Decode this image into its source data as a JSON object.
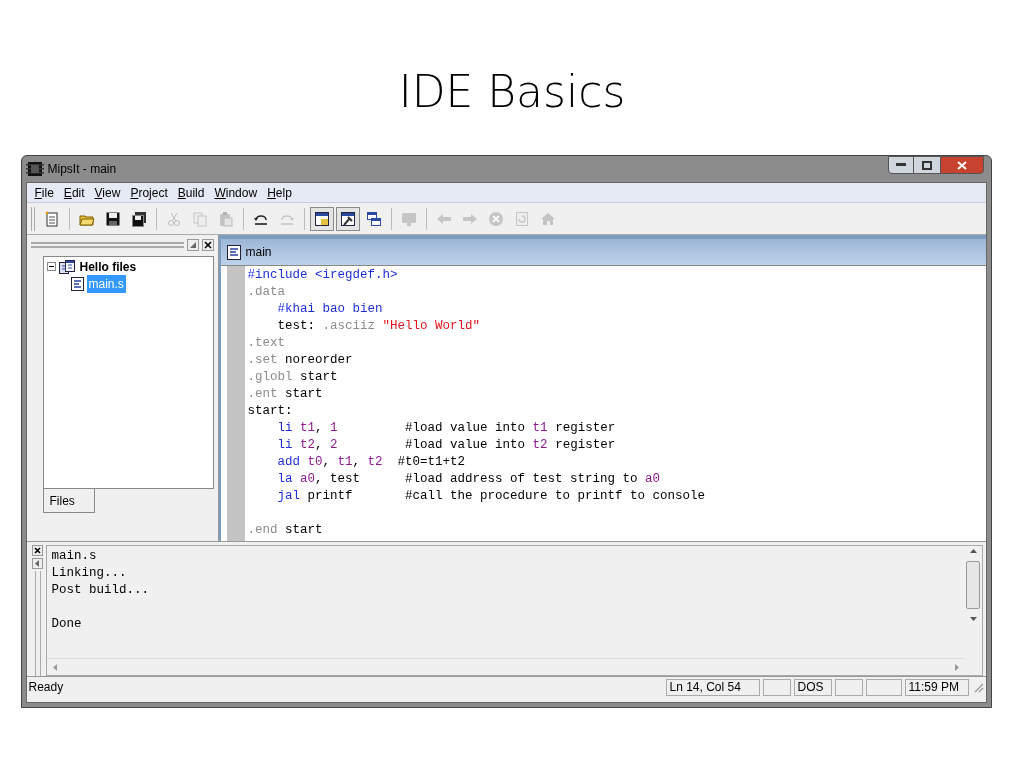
{
  "slide_title": "IDE Basics",
  "window": {
    "title": "MipsIt - main"
  },
  "menu": [
    {
      "label": "File"
    },
    {
      "label": "Edit"
    },
    {
      "label": "View"
    },
    {
      "label": "Project"
    },
    {
      "label": "Build"
    },
    {
      "label": "Window"
    },
    {
      "label": "Help"
    }
  ],
  "toolbar": [
    [
      {
        "kind": "new",
        "disabled": false,
        "pressed": false
      }
    ],
    [
      {
        "kind": "open",
        "disabled": false,
        "pressed": false
      },
      {
        "kind": "save",
        "disabled": false,
        "pressed": false
      },
      {
        "kind": "saveall",
        "disabled": false,
        "pressed": false
      }
    ],
    [
      {
        "kind": "cut",
        "disabled": true,
        "pressed": false
      },
      {
        "kind": "copy",
        "disabled": true,
        "pressed": false
      },
      {
        "kind": "paste",
        "disabled": true,
        "pressed": false
      }
    ],
    [
      {
        "kind": "undo",
        "disabled": false,
        "pressed": false
      },
      {
        "kind": "redo",
        "disabled": true,
        "pressed": false
      }
    ],
    [
      {
        "kind": "workspace",
        "disabled": false,
        "pressed": true
      },
      {
        "kind": "output",
        "disabled": false,
        "pressed": true
      },
      {
        "kind": "windows",
        "disabled": false,
        "pressed": false
      }
    ],
    [
      {
        "kind": "monitor",
        "disabled": true,
        "pressed": false
      }
    ],
    [
      {
        "kind": "back",
        "disabled": true,
        "pressed": false
      },
      {
        "kind": "forward",
        "disabled": true,
        "pressed": false
      },
      {
        "kind": "stop",
        "disabled": true,
        "pressed": false
      },
      {
        "kind": "refresh",
        "disabled": true,
        "pressed": false
      },
      {
        "kind": "home",
        "disabled": true,
        "pressed": false
      }
    ]
  ],
  "workspace": {
    "tree": [
      {
        "label": "Hello files",
        "expanded": true,
        "selected": false,
        "children": [
          {
            "label": "main.s",
            "selected": true
          }
        ]
      }
    ],
    "tabs": [
      {
        "label": "Files",
        "selected": true
      }
    ]
  },
  "editor": {
    "title": "main",
    "lines": [
      [
        {
          "kind": "kw",
          "text": "#include <iregdef.h>"
        }
      ],
      [
        {
          "kind": "dir",
          "text": ".data"
        }
      ],
      [
        {
          "kind": "kw",
          "text": "    #khai bao bien"
        }
      ],
      [
        {
          "kind": "plain",
          "text": "    test: "
        },
        {
          "kind": "dir",
          "text": ".asciiz "
        },
        {
          "kind": "str",
          "text": "\"Hello World\""
        }
      ],
      [
        {
          "kind": "dir",
          "text": ".text"
        }
      ],
      [
        {
          "kind": "dir",
          "text": ".set "
        },
        {
          "kind": "plain",
          "text": "noreorder"
        }
      ],
      [
        {
          "kind": "dir",
          "text": ".globl "
        },
        {
          "kind": "plain",
          "text": "start"
        }
      ],
      [
        {
          "kind": "dir",
          "text": ".ent "
        },
        {
          "kind": "plain",
          "text": "start"
        }
      ],
      [
        {
          "kind": "plain",
          "text": "start:"
        }
      ],
      [
        {
          "kind": "kw",
          "text": "    li "
        },
        {
          "kind": "reg",
          "text": "t1"
        },
        {
          "kind": "plain",
          "text": ", "
        },
        {
          "kind": "reg",
          "text": "1"
        },
        {
          "kind": "plain",
          "text": "         #load value into "
        },
        {
          "kind": "reg",
          "text": "t1"
        },
        {
          "kind": "plain",
          "text": " register"
        }
      ],
      [
        {
          "kind": "kw",
          "text": "    li "
        },
        {
          "kind": "reg",
          "text": "t2"
        },
        {
          "kind": "plain",
          "text": ", "
        },
        {
          "kind": "reg",
          "text": "2"
        },
        {
          "kind": "plain",
          "text": "         #load value into "
        },
        {
          "kind": "reg",
          "text": "t2"
        },
        {
          "kind": "plain",
          "text": " register"
        }
      ],
      [
        {
          "kind": "kw",
          "text": "    add "
        },
        {
          "kind": "reg",
          "text": "t0"
        },
        {
          "kind": "plain",
          "text": ", "
        },
        {
          "kind": "reg",
          "text": "t1"
        },
        {
          "kind": "plain",
          "text": ", "
        },
        {
          "kind": "reg",
          "text": "t2"
        },
        {
          "kind": "plain",
          "text": "  #t0=t1+t2"
        }
      ],
      [
        {
          "kind": "kw",
          "text": "    la "
        },
        {
          "kind": "reg",
          "text": "a0"
        },
        {
          "kind": "plain",
          "text": ", test      #load address of test string to "
        },
        {
          "kind": "reg",
          "text": "a0"
        }
      ],
      [
        {
          "kind": "kw",
          "text": "    jal "
        },
        {
          "kind": "plain",
          "text": "printf       #call the procedure to printf to console"
        }
      ],
      [
        {
          "kind": "blank"
        }
      ],
      [
        {
          "kind": "dir",
          "text": ".end "
        },
        {
          "kind": "plain",
          "text": "start"
        }
      ]
    ]
  },
  "output": {
    "blocks": [
      [
        "main.s",
        "Linking...",
        "Post build..."
      ],
      [
        "Done"
      ]
    ]
  },
  "status_bar": {
    "message": "Ready",
    "panes": [
      {
        "kind": "text",
        "text": "Ln 14, Col 54"
      },
      {
        "kind": "empty"
      },
      {
        "kind": "text",
        "text": "DOS"
      },
      {
        "kind": "empty"
      },
      {
        "kind": "empty"
      },
      {
        "kind": "text",
        "text": "11:59 PM"
      }
    ]
  }
}
